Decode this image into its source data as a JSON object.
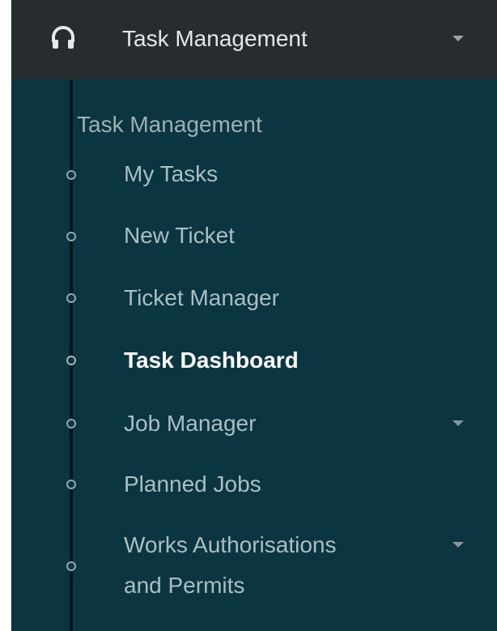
{
  "header": {
    "title": "Task Management",
    "icon": "headphones-icon"
  },
  "section": {
    "label": "Task Management"
  },
  "menu": {
    "items": [
      {
        "label": "My Tasks"
      },
      {
        "label": "New Ticket"
      },
      {
        "label": "Ticket Manager"
      },
      {
        "label": "Task Dashboard",
        "active": true
      },
      {
        "label": "Job Manager",
        "has_submenu": true
      },
      {
        "label": "Planned Jobs"
      },
      {
        "label_line1": "Works Authorisations",
        "label_line2": "and Permits",
        "has_submenu": true
      }
    ]
  },
  "colors": {
    "header_bg": "#272c2f",
    "sidebar_bg": "#0b3540",
    "active_text": "#ffffff",
    "inactive_text": "#a9bfc4"
  }
}
